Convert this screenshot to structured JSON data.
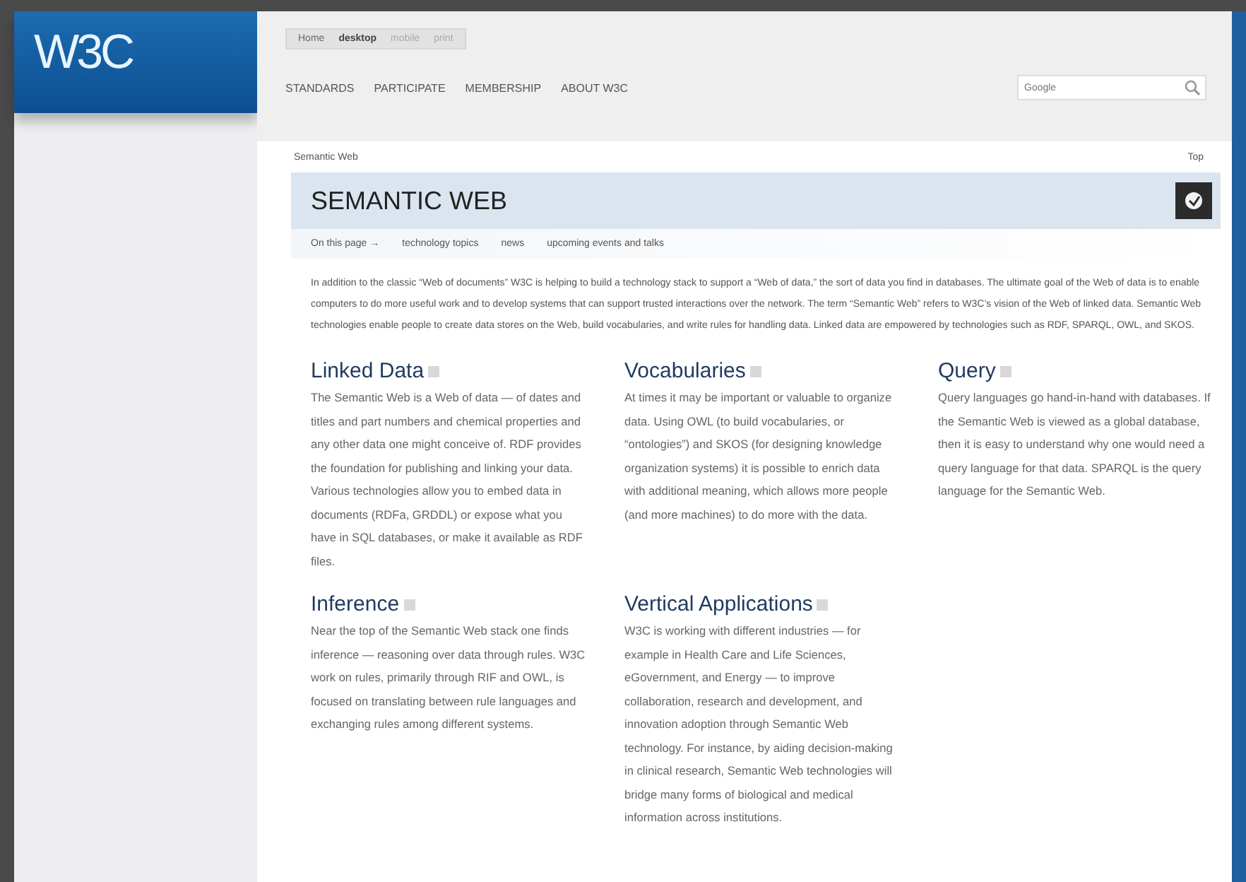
{
  "logo": {
    "text": "W3C"
  },
  "view_tabs": [
    {
      "label": "Home",
      "selected": false
    },
    {
      "label": "desktop",
      "selected": true
    },
    {
      "label": "mobile",
      "selected": false
    },
    {
      "label": "print",
      "selected": false
    }
  ],
  "nav": [
    "STANDARDS",
    "PARTICIPATE",
    "MEMBERSHIP",
    "ABOUT W3C"
  ],
  "search": {
    "placeholder": "Google"
  },
  "breadcrumb": "Semantic Web",
  "top_link": "Top",
  "page_title": "SEMANTIC WEB",
  "subnav": [
    "On this page →",
    "technology topics",
    "news",
    "upcoming events and talks"
  ],
  "intro": "In addition to the classic “Web of documents” W3C is helping to build a technology stack to support a “Web of data,” the sort of data you find in databases. The ultimate goal of the Web of data is to enable computers to do more useful work and to develop systems that can support trusted interactions over the network. The term “Semantic Web” refers to W3C’s vision of the Web of linked data. Semantic Web technologies enable people to create data stores on the Web, build vocabularies, and write rules for handling data. Linked data are empowered by technologies such as RDF, SPARQL, OWL, and SKOS.",
  "sections": [
    {
      "title": "Linked Data",
      "text": "The Semantic Web is a Web of data — of dates and titles and part numbers and chemical properties and any other data one might conceive of. RDF provides the foundation for publishing and linking your data. Various technologies allow you to embed data in documents (RDFa, GRDDL) or expose what you have in SQL databases, or make it available as RDF files."
    },
    {
      "title": "Vocabularies",
      "text": "At times it may be important or valuable to organize data. Using OWL (to build vocabularies, or “ontologies”) and SKOS (for designing knowledge organization systems) it is possible to enrich data with additional meaning, which allows more people (and more machines) to do more with the data."
    },
    {
      "title": "Query",
      "text": "Query languages go hand-in-hand with databases. If the Semantic Web is viewed as a global database, then it is easy to understand why one would need a query language for that data. SPARQL is the query language for the Semantic Web."
    },
    {
      "title": "Inference",
      "text": "Near the top of the Semantic Web stack one finds inference — reasoning over data through rules. W3C work on rules, primarily through RIF and OWL, is focused on translating between rule languages and exchanging rules among different systems."
    },
    {
      "title": "Vertical Applications",
      "text": "W3C is working with different industries — for example in Health Care and Life Sciences, eGovernment, and Energy — to improve collaboration, research and development, and innovation adoption through Semantic Web technology. For instance, by aiding decision-making in clinical research, Semantic Web technologies will bridge many forms of biological and medical information across institutions."
    }
  ]
}
